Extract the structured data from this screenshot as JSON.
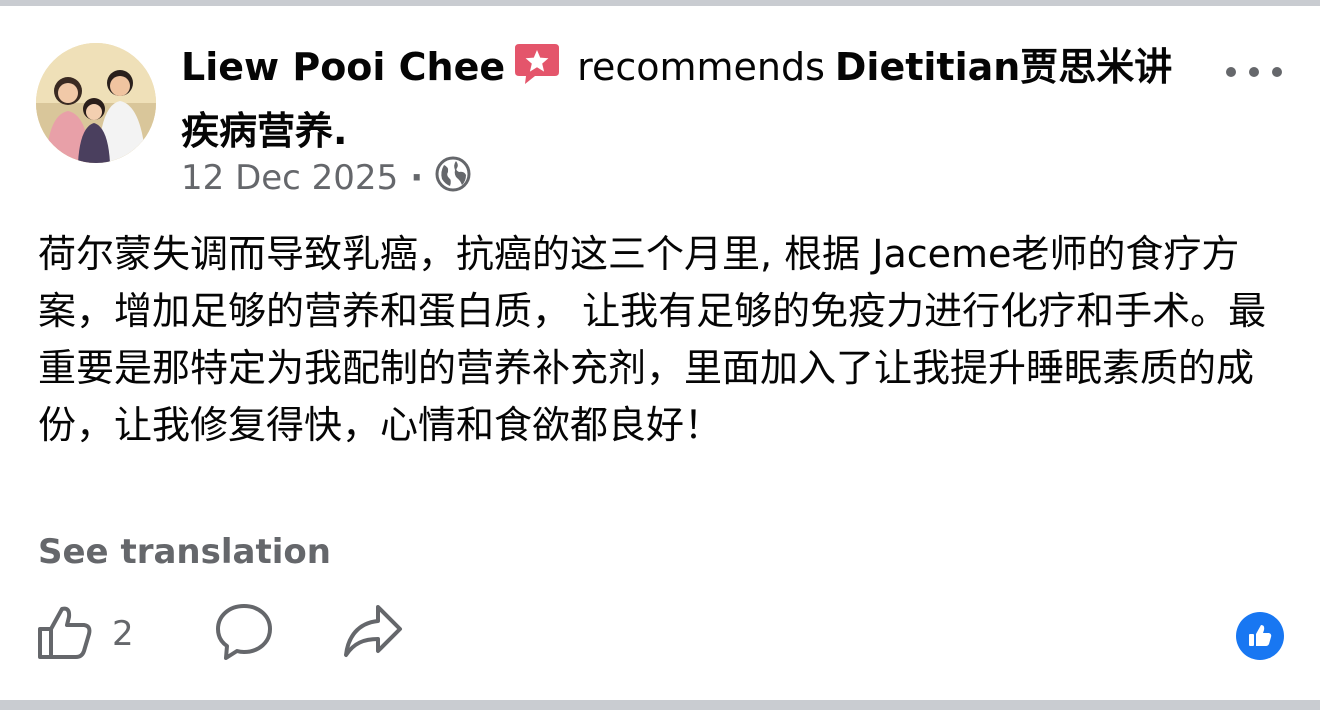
{
  "post": {
    "author_name": "Liew Pooi Chee",
    "recommendation_verb": "recommends",
    "page_name": "Dietitian贾思米讲疾病营养.",
    "date": "12 Dec 2025",
    "meta_separator": "·",
    "audience_icon": "globe-icon",
    "badge_icon": "recommend-star-icon",
    "badge_color": "#e4556b",
    "body": "荷尔蒙失调而导致乳癌，抗癌的这三个月里, 根据 Jaceme老师的食疗方案，增加足够的营养和蛋白质， 让我有足够的免疫力进行化疗和手术。最重要是那特定为我配制的营养补充剂，里面加入了让我提升睡眠素质的成份，让我修复得快，心情和食欲都良好！",
    "see_translation": "See translation"
  },
  "actions": {
    "like_icon": "thumbs-up-icon",
    "like_count": "2",
    "comment_icon": "comment-icon",
    "share_icon": "share-icon",
    "reaction_icon": "like-reaction-icon",
    "reaction_color": "#1877f2"
  },
  "colors": {
    "text_primary": "#050505",
    "text_secondary": "#65676b",
    "divider": "#c9ccd1"
  }
}
